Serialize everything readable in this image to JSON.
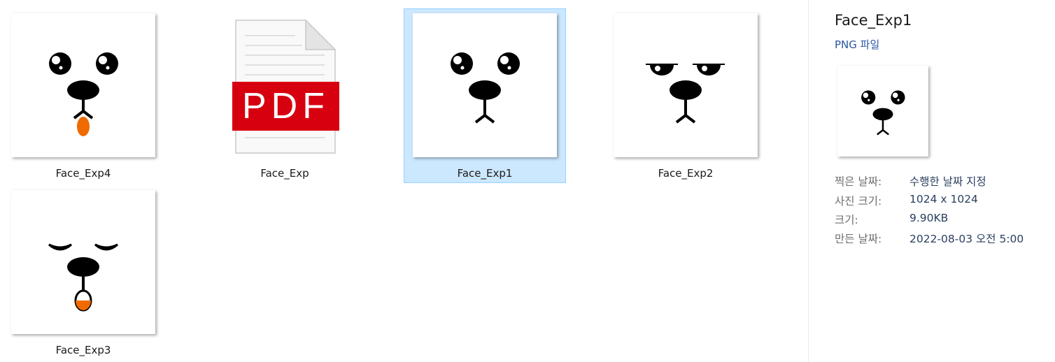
{
  "files": [
    {
      "name": "Face_Exp4",
      "kind": "face-tongue-image",
      "selected": false
    },
    {
      "name": "Face_Exp",
      "kind": "pdf-document",
      "selected": false,
      "pdf_badge": "PDF"
    },
    {
      "name": "Face_Exp1",
      "kind": "face-neutral-image",
      "selected": true
    },
    {
      "name": "Face_Exp2",
      "kind": "face-sleepy-image",
      "selected": false
    },
    {
      "name": "Face_Exp3",
      "kind": "face-sleeping-image",
      "selected": false
    }
  ],
  "details": {
    "title": "Face_Exp1",
    "type": "PNG 파일",
    "rows": [
      {
        "key": "찍은 날짜:",
        "value": "수행한 날짜 지정"
      },
      {
        "key": "사진 크기:",
        "value": "1024 x 1024"
      },
      {
        "key": "크기:",
        "value": "9.90KB"
      },
      {
        "key": "만든 날짜:",
        "value": "2022-08-03 오전 5:00"
      }
    ]
  },
  "colors": {
    "selection_fill": "#cce8ff",
    "selection_border": "#99d1ff",
    "pdf_red": "#d7000f",
    "tongue_orange": "#ef6a00"
  }
}
